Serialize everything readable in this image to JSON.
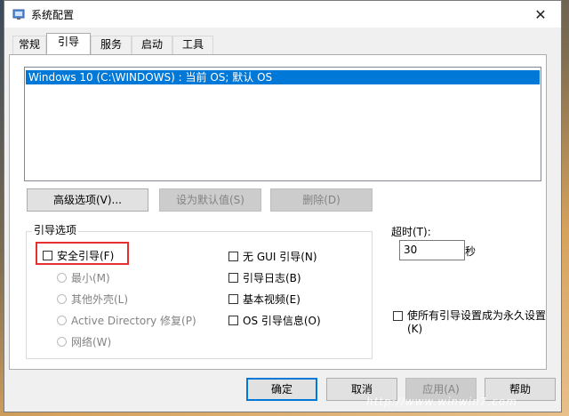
{
  "window": {
    "title": "系统配置",
    "close_glyph": "✕"
  },
  "tabs": [
    "常规",
    "引导",
    "服务",
    "启动",
    "工具"
  ],
  "os_list": {
    "selected": "Windows 10 (C:\\WINDOWS) : 当前 OS; 默认 OS"
  },
  "buttons": {
    "advanced": "高级选项(V)...",
    "set_default": "设为默认值(S)",
    "delete": "删除(D)"
  },
  "boot_options": {
    "group_label": "引导选项",
    "safe_boot": "安全引导(F)",
    "radios": [
      "最小(M)",
      "其他外壳(L)",
      "Active Directory 修复(P)",
      "网络(W)"
    ],
    "no_gui": "无 GUI 引导(N)",
    "boot_log": "引导日志(B)",
    "base_video": "基本视频(E)",
    "os_info": "OS 引导信息(O)"
  },
  "timeout": {
    "label": "超时(T):",
    "value": "30",
    "unit": "秒"
  },
  "permanent": {
    "label_line1": "使所有引导设置成为永久设置",
    "label_line2": "(K)"
  },
  "footer": {
    "ok": "确定",
    "cancel": "取消",
    "apply": "应用(A)",
    "help": "帮助"
  },
  "watermark": "http://www.winwin7.com"
}
